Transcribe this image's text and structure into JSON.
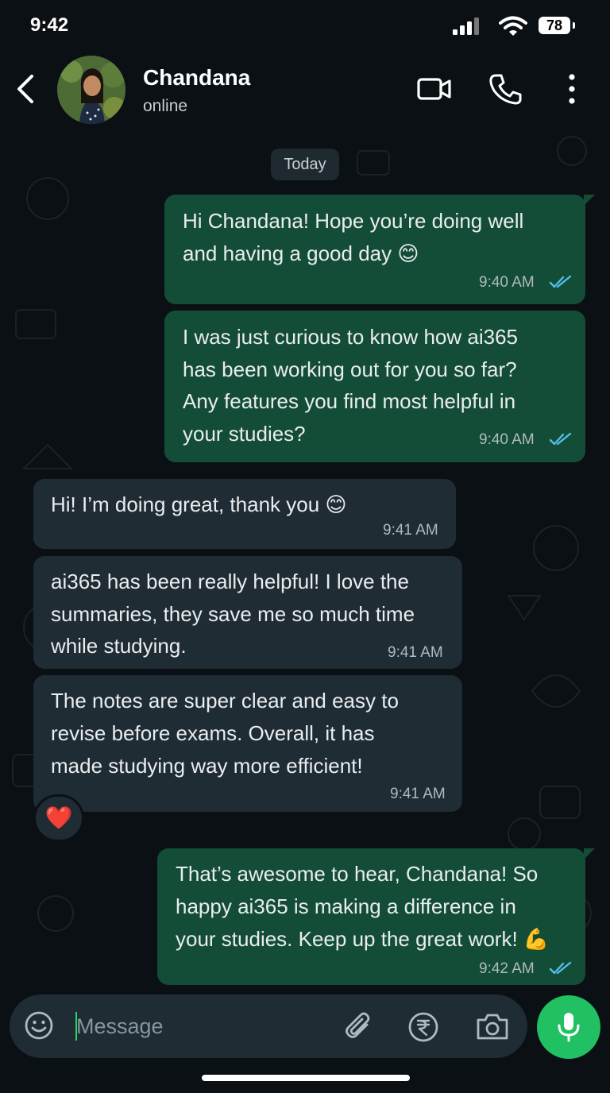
{
  "status_bar": {
    "time": "9:42",
    "battery": "78"
  },
  "header": {
    "contact_name": "Chandana",
    "contact_status": "online"
  },
  "date_chip": "Today",
  "messages": [
    {
      "direction": "outgoing",
      "lines": [
        "Hi Chandana! Hope you’re doing well",
        "and having a good day 😊"
      ],
      "time": "9:40 AM",
      "read": true
    },
    {
      "direction": "outgoing",
      "lines": [
        "I was just curious to know how ai365",
        "has been working out for you so far?",
        "Any features you find most helpful in",
        "your studies?"
      ],
      "time": "9:40 AM",
      "read": true
    },
    {
      "direction": "incoming",
      "lines": [
        "Hi! I’m doing great, thank you 😊"
      ],
      "time": "9:41 AM"
    },
    {
      "direction": "incoming",
      "lines": [
        "ai365 has been really helpful! I love the",
        "summaries, they save me so much time",
        "while studying."
      ],
      "time": "9:41 AM"
    },
    {
      "direction": "incoming",
      "lines": [
        "The notes are super clear and easy to",
        "revise before exams. Overall, it has",
        "made studying way more efficient!"
      ],
      "time": "9:41 AM",
      "reaction": "❤️"
    },
    {
      "direction": "outgoing",
      "lines": [
        "That’s awesome to hear, Chandana! So",
        "happy ai365 is making a difference in",
        "your studies. Keep up the great work! 💪"
      ],
      "time": "9:42 AM",
      "read": true
    }
  ],
  "composer": {
    "placeholder": "Message"
  },
  "colors": {
    "background": "#0b1014",
    "outgoing_bubble": "#144d37",
    "incoming_bubble": "#1f2c33",
    "read_tick": "#53bdeb",
    "mic_button": "#21c063"
  },
  "icons": [
    "back-arrow-icon",
    "video-call-icon",
    "phone-icon",
    "more-vertical-icon",
    "emoji-icon",
    "attach-icon",
    "rupee-icon",
    "camera-icon",
    "mic-icon",
    "double-check-icon",
    "heart-icon"
  ]
}
